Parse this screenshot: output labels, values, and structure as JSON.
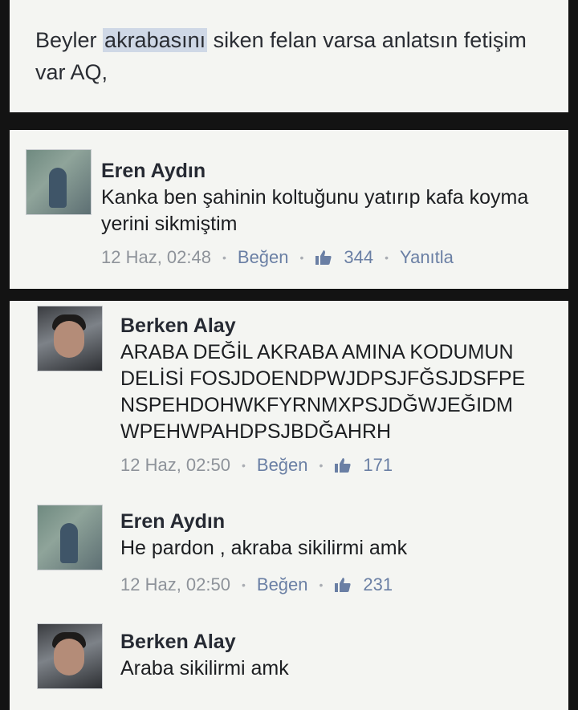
{
  "post": {
    "text_before": "Beyler ",
    "text_highlight": "akrabasını",
    "text_after": " siken felan varsa anlatsın fetişim var AQ,"
  },
  "comments": [
    {
      "author": "Eren Aydın",
      "text": "Kanka ben şahinin koltuğunu yatırıp kafa koyma yerini sikmiştim",
      "time": "12 Haz, 02:48",
      "like_label": "Beğen",
      "likes": "344",
      "reply_label": "Yanıtla",
      "avatar": "avatar-dim-room-photo"
    },
    {
      "author": "Berken Alay",
      "text": "ARABA DEĞİL AKRABA AMINA KODUMUN DELİSİ FOSJDOENDPWJDPSJFĞSJDSFPE NSPEHDOHWKFYRNMXPSJDĞWJEĞIDM WPEHWPAHDPSJBDĞAHRH",
      "time": "12 Haz, 02:50",
      "like_label": "Beğen",
      "likes": "171",
      "avatar": "avatar-selfie-photo"
    },
    {
      "author": "Eren Aydın",
      "text": "He pardon , akraba sikilirmi amk",
      "time": "12 Haz, 02:50",
      "like_label": "Beğen",
      "likes": "231",
      "avatar": "avatar-dim-room-photo"
    },
    {
      "author": "Berken Alay",
      "text": "Araba sikilirmi amk",
      "avatar": "avatar-selfie-photo"
    }
  ],
  "icons": {
    "like": "thumbs-up-icon"
  },
  "colors": {
    "link": "#6a7fa4",
    "muted": "#8e939a",
    "panel": "#f4f5f2",
    "separator": "#131313"
  }
}
